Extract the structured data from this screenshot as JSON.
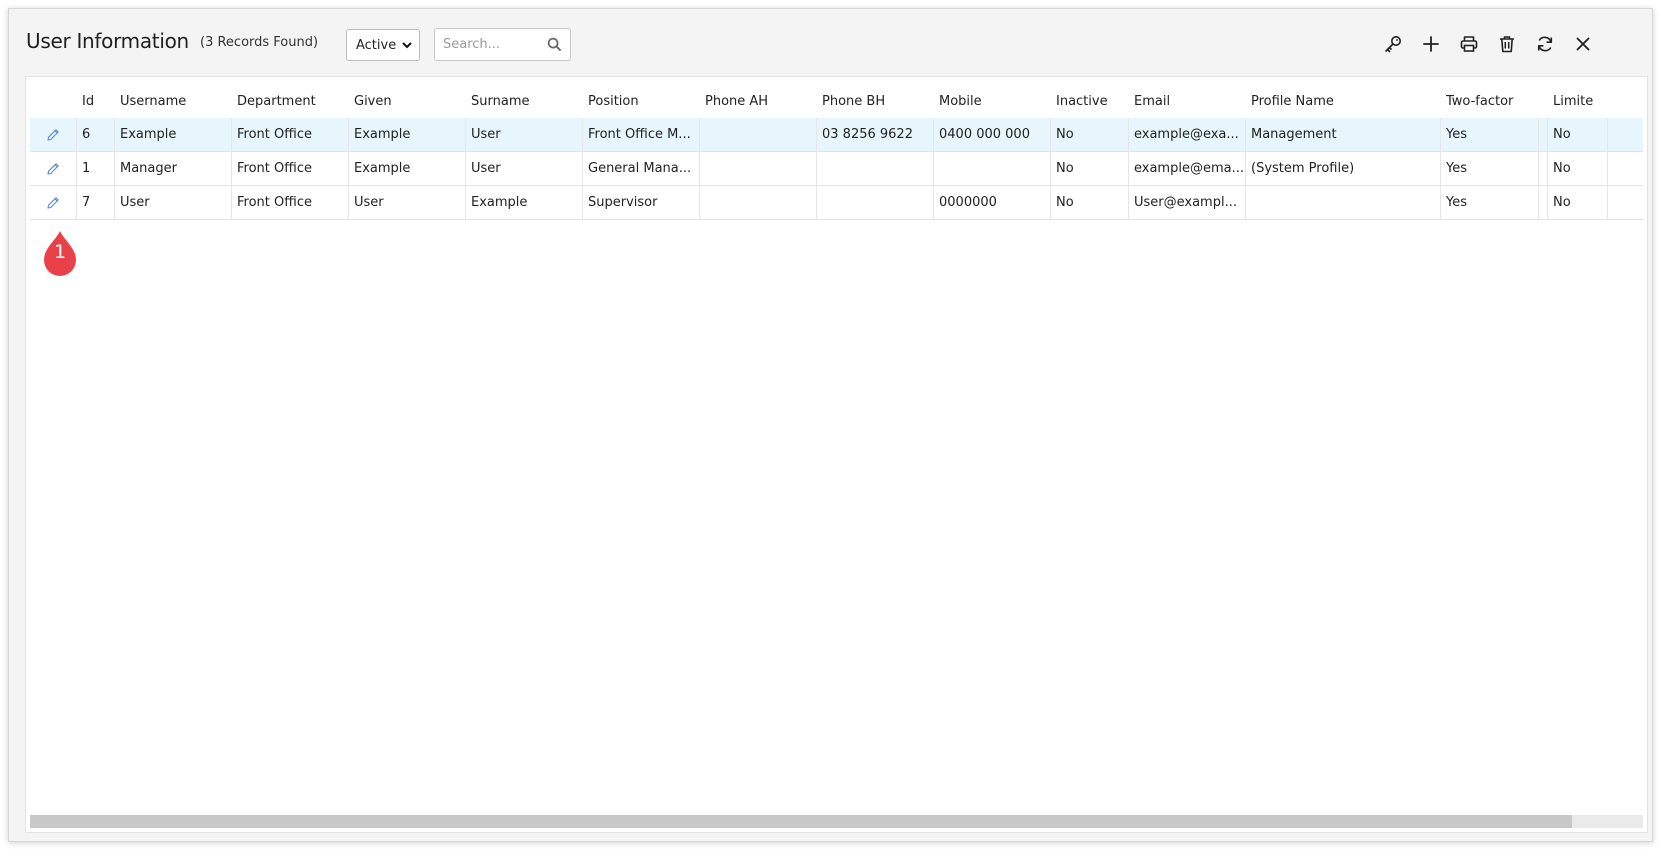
{
  "window": {
    "title": "User Information",
    "record_count": "(3 Records Found)"
  },
  "filter": {
    "status": {
      "value": "Active"
    },
    "search_placeholder": "Search..."
  },
  "toolbar": {
    "icons": [
      "key-icon",
      "plus-icon",
      "printer-icon",
      "trash-icon",
      "refresh-icon",
      "close-icon"
    ]
  },
  "table": {
    "columns": [
      "",
      "Id",
      "Username",
      "Department",
      "Given",
      "Surname",
      "Position",
      "Phone AH",
      "Phone BH",
      "Mobile",
      "Inactive",
      "Email",
      "Profile Name",
      "Two-factor",
      "",
      "Limite"
    ],
    "rows": [
      {
        "id": "6",
        "username": "Example",
        "department": "Front Office",
        "given": "Example",
        "surname": "User",
        "position": "Front Office M...",
        "phone_ah": "",
        "phone_bh": "03 8256 9622",
        "mobile": "0400 000 000",
        "inactive": "No",
        "email": "example@exa...",
        "profile_name": "Management",
        "two_factor": "Yes",
        "limited": "No"
      },
      {
        "id": "1",
        "username": "Manager",
        "department": "Front Office",
        "given": "Example",
        "surname": "User",
        "position": "General Mana...",
        "phone_ah": "",
        "phone_bh": "",
        "mobile": "",
        "inactive": "No",
        "email": "example@ema...",
        "profile_name": "(System Profile)",
        "two_factor": "Yes",
        "limited": "No"
      },
      {
        "id": "7",
        "username": "User",
        "department": "Front Office",
        "given": "User",
        "surname": "Example",
        "position": "Supervisor",
        "phone_ah": "",
        "phone_bh": "",
        "mobile": "0000000",
        "inactive": "No",
        "email": "User@exampl...",
        "profile_name": "",
        "two_factor": "Yes",
        "limited": "No"
      }
    ]
  },
  "callout": {
    "label": "1"
  },
  "colors": {
    "selected_row": "#e6f6fc",
    "callout": "#e8414a",
    "edit_icon": "#5a8fcf"
  }
}
